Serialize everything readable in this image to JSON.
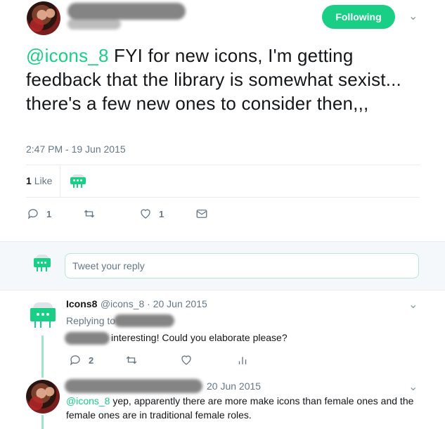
{
  "header": {
    "follow_label": "Following"
  },
  "tweet": {
    "mention": "@icons_8",
    "text": " FYI for new icons, I'm getting feedback that the library is somewhat sexist... there's a few new ones to consider then,,,",
    "timestamp": "2:47 PM - 19 Jun 2015",
    "likes_count": "1",
    "likes_label": "Like",
    "actions": {
      "reply_count": "1",
      "like_count": "1"
    }
  },
  "reply_box": {
    "placeholder": "Tweet your reply"
  },
  "replies": [
    {
      "name": "Icons8",
      "handle_date": "@icons_8 · 20 Jun 2015",
      "replying_to": "Replying to",
      "text": "interesting! Could you elaborate please?",
      "reply_count": "2"
    },
    {
      "date": "20 Jun 2015",
      "mention": "@icons_8",
      "text": " yep, apparently there are more make icons than female ones and the female ones are in traditional female roles."
    }
  ],
  "colors": {
    "accent": "#19cf86",
    "muted": "#657786"
  }
}
